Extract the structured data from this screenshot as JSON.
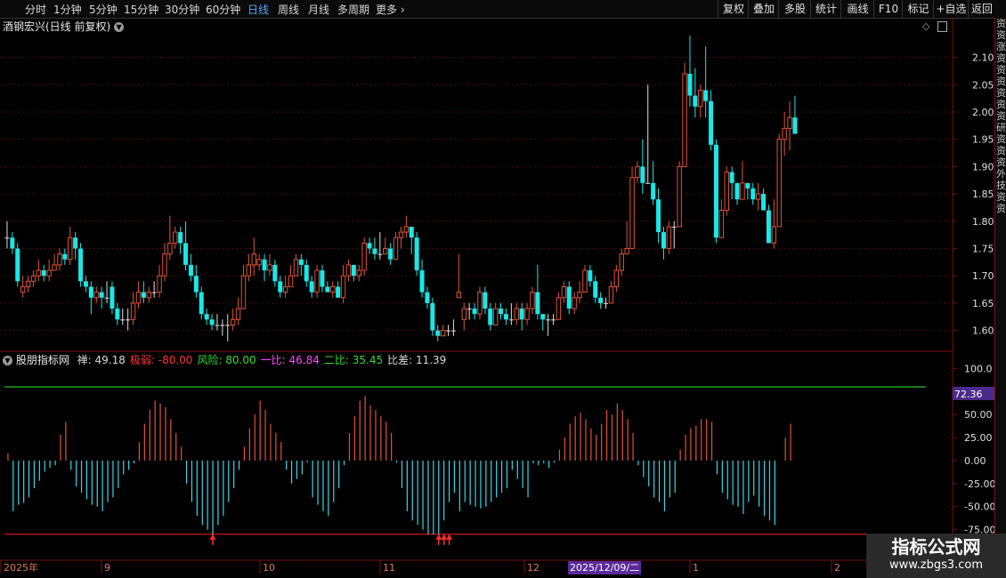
{
  "topbar": {
    "tabs": [
      {
        "label": "分时",
        "active": false
      },
      {
        "label": "1分钟",
        "active": false
      },
      {
        "label": "5分钟",
        "active": false
      },
      {
        "label": "15分钟",
        "active": false
      },
      {
        "label": "30分钟",
        "active": false
      },
      {
        "label": "60分钟",
        "active": false
      },
      {
        "label": "日线",
        "active": true
      },
      {
        "label": "周线",
        "active": false
      },
      {
        "label": "月线",
        "active": false
      },
      {
        "label": "多周期",
        "active": false
      },
      {
        "label": "更多",
        "active": false
      }
    ],
    "right_buttons": [
      "复权",
      "叠加",
      "多股",
      "统计",
      "画线",
      "F10",
      "标记",
      "+自选",
      "返回"
    ]
  },
  "price_panel": {
    "title": "酒钢宏兴(日线 前复权)",
    "y_ticks": [
      "2.10",
      "2.05",
      "2.00",
      "1.95",
      "1.90",
      "1.85",
      "1.80",
      "1.75",
      "1.70",
      "1.65",
      "1.60"
    ]
  },
  "indicator_panel": {
    "name": "股朋指标网",
    "items": [
      {
        "label": "禅:",
        "value": "49.18",
        "color": "#d8d8d8"
      },
      {
        "label": "极弱:",
        "value": "-80.00",
        "color": "#ff3333"
      },
      {
        "label": "风险:",
        "value": "80.00",
        "color": "#33dd33"
      },
      {
        "label": "一比:",
        "value": "46.84",
        "color": "#ff44ff"
      },
      {
        "label": "二比:",
        "value": "35.45",
        "color": "#33dd33"
      },
      {
        "label": "比差:",
        "value": "11.39",
        "color": "#d8d8d8"
      }
    ],
    "y_ticks": [
      "100.0",
      "75.00",
      "50.00",
      "25.00",
      "0.00",
      "-25.00",
      "-50.00",
      "-75.00"
    ],
    "marker_value": "72.36"
  },
  "time_axis": {
    "labels": [
      "2025年",
      "9",
      "10",
      "11",
      "12",
      "2025/12/09/二",
      "1",
      "2"
    ]
  },
  "right_strip": "资资涨资资资资资资研资资资外技资资",
  "watermark": {
    "line1": "指标公式网",
    "line2": "www.zbgs3.com"
  },
  "chart_data": {
    "type": "candlestick",
    "title": "酒钢宏兴(日线 前复权)",
    "ylim": [
      1.57,
      2.14
    ],
    "indicator_ylim": [
      -85,
      110
    ],
    "colors": {
      "up": "#e2533a",
      "down": "#18e8e8",
      "flat": "#e0e0e0",
      "red_line": "#e21b1b",
      "green_line": "#2bd52b"
    },
    "candles": [
      [
        1.77,
        1.77,
        1.8,
        1.75
      ],
      [
        1.77,
        1.75,
        1.78,
        1.74
      ],
      [
        1.75,
        1.69,
        1.76,
        1.68
      ],
      [
        1.67,
        1.68,
        1.7,
        1.66
      ],
      [
        1.68,
        1.69,
        1.7,
        1.67
      ],
      [
        1.69,
        1.7,
        1.71,
        1.68
      ],
      [
        1.7,
        1.71,
        1.73,
        1.69
      ],
      [
        1.71,
        1.7,
        1.72,
        1.69
      ],
      [
        1.7,
        1.71,
        1.73,
        1.69
      ],
      [
        1.71,
        1.72,
        1.74,
        1.71
      ],
      [
        1.72,
        1.74,
        1.75,
        1.71
      ],
      [
        1.74,
        1.73,
        1.75,
        1.72
      ],
      [
        1.73,
        1.77,
        1.79,
        1.72
      ],
      [
        1.77,
        1.75,
        1.78,
        1.73
      ],
      [
        1.75,
        1.69,
        1.76,
        1.68
      ],
      [
        1.69,
        1.68,
        1.7,
        1.67
      ],
      [
        1.68,
        1.66,
        1.69,
        1.63
      ],
      [
        1.66,
        1.67,
        1.68,
        1.65
      ],
      [
        1.67,
        1.66,
        1.68,
        1.64
      ],
      [
        1.66,
        1.66,
        1.69,
        1.65
      ],
      [
        1.68,
        1.64,
        1.69,
        1.63
      ],
      [
        1.64,
        1.62,
        1.65,
        1.61
      ],
      [
        1.62,
        1.62,
        1.64,
        1.61
      ],
      [
        1.62,
        1.62,
        1.64,
        1.6
      ],
      [
        1.62,
        1.65,
        1.67,
        1.61
      ],
      [
        1.65,
        1.67,
        1.69,
        1.64
      ],
      [
        1.67,
        1.66,
        1.69,
        1.65
      ],
      [
        1.66,
        1.67,
        1.68,
        1.65
      ],
      [
        1.67,
        1.67,
        1.69,
        1.66
      ],
      [
        1.67,
        1.7,
        1.72,
        1.66
      ],
      [
        1.7,
        1.74,
        1.76,
        1.69
      ],
      [
        1.74,
        1.76,
        1.81,
        1.73
      ],
      [
        1.76,
        1.78,
        1.79,
        1.75
      ],
      [
        1.78,
        1.76,
        1.79,
        1.74
      ],
      [
        1.76,
        1.72,
        1.8,
        1.71
      ],
      [
        1.72,
        1.7,
        1.74,
        1.69
      ],
      [
        1.7,
        1.67,
        1.72,
        1.66
      ],
      [
        1.67,
        1.63,
        1.68,
        1.62
      ],
      [
        1.63,
        1.62,
        1.64,
        1.61
      ],
      [
        1.62,
        1.61,
        1.63,
        1.6
      ],
      [
        1.61,
        1.61,
        1.63,
        1.6
      ],
      [
        1.61,
        1.61,
        1.62,
        1.59
      ],
      [
        1.61,
        1.61,
        1.63,
        1.58
      ],
      [
        1.61,
        1.62,
        1.64,
        1.6
      ],
      [
        1.62,
        1.64,
        1.66,
        1.61
      ],
      [
        1.64,
        1.7,
        1.72,
        1.64
      ],
      [
        1.7,
        1.72,
        1.74,
        1.69
      ],
      [
        1.72,
        1.74,
        1.77,
        1.7
      ],
      [
        1.72,
        1.73,
        1.74,
        1.71
      ],
      [
        1.73,
        1.71,
        1.74,
        1.69
      ],
      [
        1.71,
        1.72,
        1.74,
        1.7
      ],
      [
        1.72,
        1.69,
        1.73,
        1.68
      ],
      [
        1.69,
        1.67,
        1.7,
        1.66
      ],
      [
        1.67,
        1.68,
        1.7,
        1.66
      ],
      [
        1.68,
        1.7,
        1.72,
        1.68
      ],
      [
        1.7,
        1.73,
        1.74,
        1.7
      ],
      [
        1.73,
        1.72,
        1.74,
        1.7
      ],
      [
        1.72,
        1.69,
        1.73,
        1.68
      ],
      [
        1.69,
        1.67,
        1.7,
        1.66
      ],
      [
        1.67,
        1.71,
        1.72,
        1.66
      ],
      [
        1.71,
        1.68,
        1.72,
        1.67
      ],
      [
        1.68,
        1.67,
        1.69,
        1.67
      ],
      [
        1.67,
        1.68,
        1.69,
        1.66
      ],
      [
        1.68,
        1.66,
        1.69,
        1.66
      ],
      [
        1.66,
        1.7,
        1.72,
        1.65
      ],
      [
        1.7,
        1.72,
        1.73,
        1.69
      ],
      [
        1.72,
        1.7,
        1.72,
        1.69
      ],
      [
        1.7,
        1.71,
        1.72,
        1.69
      ],
      [
        1.71,
        1.76,
        1.77,
        1.7
      ],
      [
        1.76,
        1.75,
        1.77,
        1.74
      ],
      [
        1.75,
        1.74,
        1.77,
        1.73
      ],
      [
        1.74,
        1.74,
        1.78,
        1.73
      ],
      [
        1.74,
        1.75,
        1.77,
        1.74
      ],
      [
        1.75,
        1.73,
        1.76,
        1.72
      ],
      [
        1.73,
        1.77,
        1.78,
        1.73
      ],
      [
        1.77,
        1.78,
        1.79,
        1.75
      ],
      [
        1.78,
        1.79,
        1.81,
        1.77
      ],
      [
        1.79,
        1.77,
        1.79,
        1.74
      ],
      [
        1.77,
        1.71,
        1.78,
        1.7
      ],
      [
        1.71,
        1.67,
        1.73,
        1.66
      ],
      [
        1.67,
        1.65,
        1.68,
        1.64
      ],
      [
        1.65,
        1.6,
        1.66,
        1.59
      ],
      [
        1.6,
        1.59,
        1.61,
        1.58
      ],
      [
        1.59,
        1.6,
        1.61,
        1.59
      ],
      [
        1.6,
        1.6,
        1.61,
        1.59
      ],
      [
        1.6,
        1.6,
        1.62,
        1.59
      ],
      [
        1.66,
        1.67,
        1.74,
        1.66
      ],
      [
        1.62,
        1.64,
        1.65,
        1.6
      ],
      [
        1.64,
        1.64,
        1.65,
        1.62
      ],
      [
        1.64,
        1.63,
        1.65,
        1.62
      ],
      [
        1.63,
        1.67,
        1.68,
        1.62
      ],
      [
        1.67,
        1.64,
        1.68,
        1.63
      ],
      [
        1.64,
        1.61,
        1.65,
        1.6
      ],
      [
        1.61,
        1.64,
        1.65,
        1.61
      ],
      [
        1.64,
        1.63,
        1.65,
        1.62
      ],
      [
        1.63,
        1.62,
        1.64,
        1.61
      ],
      [
        1.62,
        1.62,
        1.65,
        1.61
      ],
      [
        1.62,
        1.64,
        1.65,
        1.61
      ],
      [
        1.64,
        1.62,
        1.65,
        1.6
      ],
      [
        1.62,
        1.64,
        1.65,
        1.61
      ],
      [
        1.64,
        1.67,
        1.68,
        1.63
      ],
      [
        1.67,
        1.63,
        1.72,
        1.62
      ],
      [
        1.63,
        1.62,
        1.63,
        1.6
      ],
      [
        1.62,
        1.62,
        1.63,
        1.59
      ],
      [
        1.62,
        1.62,
        1.63,
        1.61
      ],
      [
        1.62,
        1.66,
        1.67,
        1.62
      ],
      [
        1.66,
        1.68,
        1.69,
        1.65
      ],
      [
        1.68,
        1.64,
        1.69,
        1.63
      ],
      [
        1.64,
        1.66,
        1.67,
        1.63
      ],
      [
        1.66,
        1.67,
        1.69,
        1.65
      ],
      [
        1.67,
        1.71,
        1.72,
        1.67
      ],
      [
        1.71,
        1.69,
        1.72,
        1.68
      ],
      [
        1.69,
        1.66,
        1.7,
        1.65
      ],
      [
        1.66,
        1.65,
        1.67,
        1.64
      ],
      [
        1.65,
        1.65,
        1.66,
        1.64
      ],
      [
        1.65,
        1.68,
        1.69,
        1.65
      ],
      [
        1.68,
        1.71,
        1.72,
        1.67
      ],
      [
        1.71,
        1.74,
        1.75,
        1.7
      ],
      [
        1.74,
        1.75,
        1.8,
        1.74
      ],
      [
        1.75,
        1.88,
        1.9,
        1.75
      ],
      [
        1.88,
        1.9,
        1.91,
        1.87
      ],
      [
        1.9,
        1.87,
        1.95,
        1.85
      ],
      [
        1.87,
        1.87,
        2.05,
        1.87
      ],
      [
        1.87,
        1.84,
        1.91,
        1.83
      ],
      [
        1.84,
        1.78,
        1.86,
        1.76
      ],
      [
        1.78,
        1.75,
        1.79,
        1.73
      ],
      [
        1.75,
        1.79,
        1.8,
        1.74
      ],
      [
        1.79,
        1.79,
        1.8,
        1.75
      ],
      [
        1.79,
        1.9,
        1.91,
        1.79
      ],
      [
        1.9,
        2.07,
        2.09,
        1.9
      ],
      [
        2.07,
        2.03,
        2.14,
        2.01
      ],
      [
        2.03,
        2.01,
        2.08,
        1.99
      ],
      [
        2.01,
        2.04,
        2.05,
        1.99
      ],
      [
        2.04,
        2.02,
        2.12,
        1.99
      ],
      [
        2.02,
        1.94,
        2.04,
        1.93
      ],
      [
        1.94,
        1.77,
        1.95,
        1.76
      ],
      [
        1.77,
        1.82,
        1.84,
        1.77
      ],
      [
        1.82,
        1.89,
        1.9,
        1.81
      ],
      [
        1.89,
        1.87,
        1.9,
        1.84
      ],
      [
        1.87,
        1.84,
        1.87,
        1.83
      ],
      [
        1.84,
        1.87,
        1.91,
        1.84
      ],
      [
        1.87,
        1.86,
        1.87,
        1.84
      ],
      [
        1.86,
        1.84,
        1.87,
        1.83
      ],
      [
        1.84,
        1.85,
        1.87,
        1.82
      ],
      [
        1.85,
        1.82,
        1.86,
        1.82
      ],
      [
        1.82,
        1.76,
        1.83,
        1.76
      ],
      [
        1.76,
        1.79,
        1.84,
        1.75
      ],
      [
        1.79,
        1.95,
        1.96,
        1.79
      ],
      [
        1.95,
        1.97,
        2.0,
        1.92
      ],
      [
        1.97,
        1.99,
        2.02,
        1.93
      ],
      [
        1.99,
        1.96,
        2.03,
        1.96
      ]
    ],
    "indicator_values": [
      8,
      -55,
      -48,
      -46,
      -40,
      -30,
      -22,
      -12,
      -8,
      -5,
      28,
      42,
      -10,
      -28,
      -35,
      -42,
      -48,
      -50,
      -55,
      -45,
      -40,
      -30,
      -15,
      -10,
      -3,
      20,
      40,
      55,
      65,
      62,
      58,
      45,
      30,
      15,
      -25,
      -45,
      -60,
      -70,
      -75,
      -80,
      -70,
      -60,
      -45,
      -30,
      -10,
      15,
      35,
      50,
      65,
      55,
      40,
      30,
      20,
      -10,
      -25,
      -20,
      -15,
      -2,
      -40,
      -48,
      -55,
      -60,
      -45,
      -30,
      -5,
      30,
      48,
      65,
      70,
      60,
      55,
      48,
      42,
      30,
      -2,
      -30,
      -55,
      -65,
      -70,
      -75,
      -80,
      -80,
      -80,
      -65,
      -45,
      -35,
      -55,
      -45,
      -48,
      -50,
      -52,
      -50,
      -45,
      -40,
      -35,
      -30,
      -10,
      -20,
      -30,
      -40,
      -3,
      -5,
      -3,
      -8,
      -2,
      12,
      25,
      40,
      48,
      52,
      45,
      35,
      28,
      40,
      55,
      50,
      62,
      55,
      45,
      30,
      -5,
      -18,
      -28,
      -40,
      -45,
      -55,
      -40,
      -35,
      12,
      28,
      35,
      38,
      45,
      45,
      42,
      -15,
      -35,
      -42,
      -48,
      -50,
      -58,
      -45,
      -38,
      -50,
      -60,
      -65,
      -70,
      0,
      25,
      40
    ],
    "buy_signals": [
      39,
      82,
      83,
      84
    ],
    "risk_line": 80,
    "weak_line": -80
  }
}
